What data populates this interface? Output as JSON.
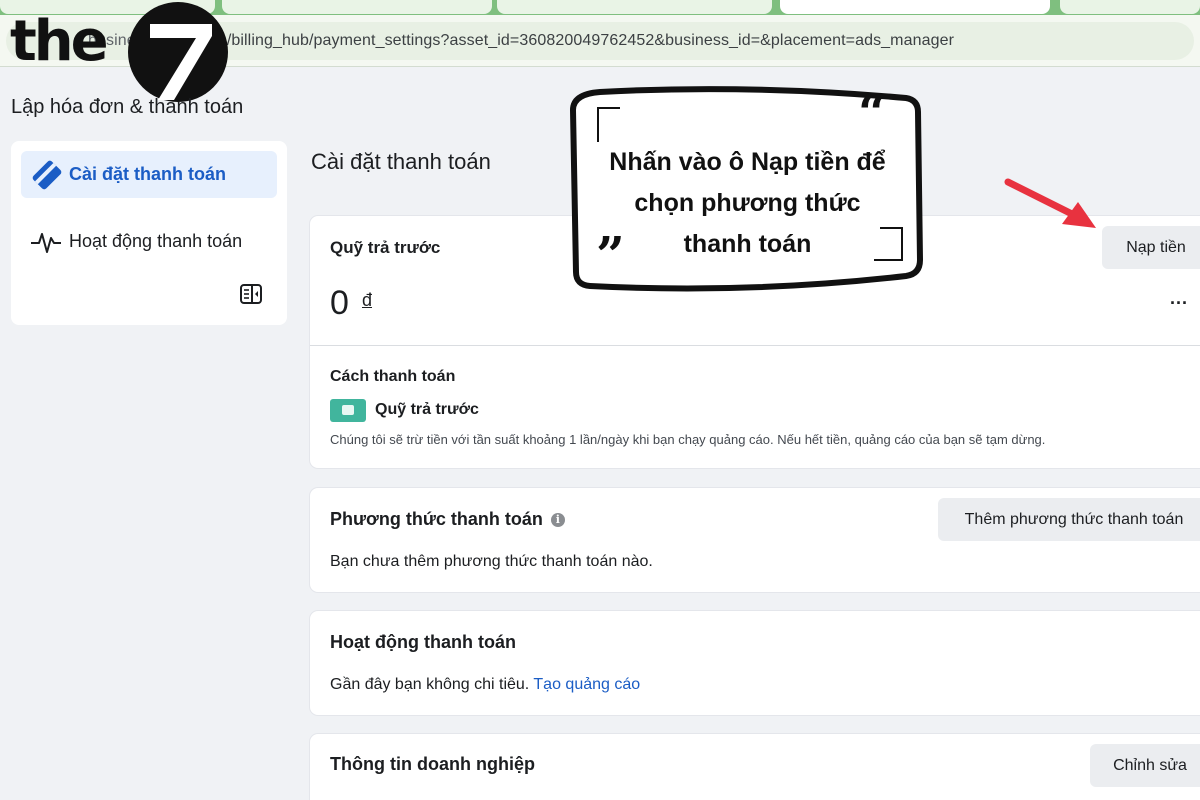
{
  "browser": {
    "url_prefix": "busine",
    "url": ".com/billing_hub/payment_settings?asset_id=360820049762452&business_id=&placement=ads_manager"
  },
  "logo": {
    "text": "the",
    "numeral": "7"
  },
  "page_title": "Lập hóa đơn & thanh toán",
  "sidebar": {
    "items": [
      {
        "label": "Cài đặt thanh toán",
        "icon": "credit-card-icon",
        "active": true
      },
      {
        "label": "Hoạt động thanh toán",
        "icon": "activity-pulse-icon",
        "active": false
      }
    ],
    "collapse_icon": "sidebar-toggle-icon"
  },
  "main": {
    "title": "Cài đặt thanh toán",
    "prepaid": {
      "title": "Quỹ trả trước",
      "button": "Nạp tiền",
      "balance": "0",
      "currency": "đ",
      "more": "...",
      "payment_method_label": "Cách thanh toán",
      "payment_method_name": "Quỹ trả trước",
      "description": "Chúng tôi sẽ trừ tiền với tần suất khoảng 1 lần/ngày khi bạn chạy quảng cáo. Nếu hết tiền, quảng cáo của bạn sẽ tạm dừng."
    },
    "payment_methods": {
      "title": "Phương thức thanh toán",
      "info": "i",
      "button": "Thêm phương thức thanh toán",
      "empty_text": "Bạn chưa thêm phương thức thanh toán nào."
    },
    "payment_activity": {
      "title": "Hoạt động thanh toán",
      "text": "Gần đây bạn không chi tiêu.",
      "link": "Tạo quảng cáo"
    },
    "business_info": {
      "title": "Thông tin doanh nghiệp",
      "button": "Chỉnh sửa"
    }
  },
  "callout": {
    "open_quote": "“",
    "close_quote": "”",
    "line1": "Nhấn vào ô Nạp tiền để",
    "line2": "chọn phương thức",
    "line3": "thanh toán"
  },
  "colors": {
    "accent": "#1b5dc5",
    "active_bg": "#e7f0fd",
    "wallet_green": "#41b59d",
    "arrow_red": "#e8323f",
    "tab_green": "#7fbf7f"
  }
}
